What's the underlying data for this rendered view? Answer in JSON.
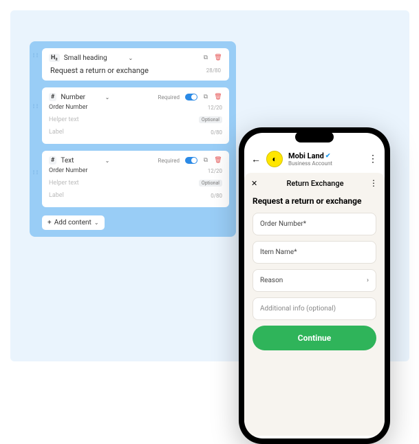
{
  "builder": {
    "heading_block": {
      "type_label": "H₂",
      "type_name": "Small heading",
      "value": "Request a return or exchange",
      "counter": "28/80"
    },
    "blocks": [
      {
        "icon": "#",
        "type": "Number",
        "required_label": "Required",
        "label_row": {
          "text": "Order Number",
          "counter": "12/20"
        },
        "helper_row": {
          "text": "Helper text",
          "chip": "Optional"
        },
        "value_row": {
          "text": "Label",
          "counter": "0/80"
        }
      },
      {
        "icon": "#",
        "type": "Text",
        "required_label": "Required",
        "label_row": {
          "text": "Order Number",
          "counter": "12/20"
        },
        "helper_row": {
          "text": "Helper text",
          "chip": "Optional"
        },
        "value_row": {
          "text": "Label",
          "counter": "0/80"
        }
      }
    ],
    "add_label": "Add content"
  },
  "phone": {
    "business": {
      "name": "Mobi Land",
      "subtitle": "Business Account"
    },
    "flow_title": "Return Exchange",
    "form_title": "Request a return or exchange",
    "fields": {
      "order": "Order Number*",
      "item": "Item Name*",
      "reason": "Reason",
      "info": "Additional info (optional)"
    },
    "cta": "Continue"
  }
}
